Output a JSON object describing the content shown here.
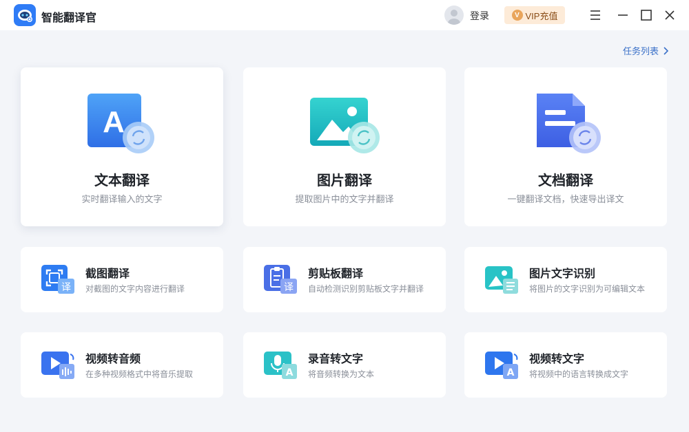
{
  "app": {
    "title": "智能翻译官",
    "login": "登录",
    "vip_label": "VIP充值",
    "vip_badge": "V"
  },
  "task_list": {
    "label": "任务列表"
  },
  "big_cards": [
    {
      "title": "文本翻译",
      "desc": "实时翻译输入的文字",
      "icon": "text-translate-icon"
    },
    {
      "title": "图片翻译",
      "desc": "提取图片中的文字并翻译",
      "icon": "image-translate-icon"
    },
    {
      "title": "文档翻译",
      "desc": "一键翻译文档，快速导出译文",
      "icon": "document-translate-icon"
    }
  ],
  "small_cards": [
    {
      "title": "截图翻译",
      "desc": "对截图的文字内容进行翻译",
      "icon": "screenshot-translate-icon",
      "badge": "译"
    },
    {
      "title": "剪贴板翻译",
      "desc": "自动检测识别剪贴板文字并翻译",
      "icon": "clipboard-translate-icon",
      "badge": "译"
    },
    {
      "title": "图片文字识别",
      "desc": "将图片的文字识别为可编辑文本",
      "icon": "image-ocr-icon"
    },
    {
      "title": "视频转音频",
      "desc": "在多种视频格式中将音乐提取",
      "icon": "video-to-audio-icon"
    },
    {
      "title": "录音转文字",
      "desc": "将音频转换为文本",
      "icon": "audio-to-text-icon",
      "badge": "A"
    },
    {
      "title": "视频转文字",
      "desc": "将视频中的语言转换成文字",
      "icon": "video-to-text-icon",
      "badge": "A"
    }
  ],
  "big_icon_letter": "A",
  "colors": {
    "brand": "#2f7cf6",
    "link": "#3a70c8",
    "vip_bg": "#fdebd8",
    "background": "#f3f5f9"
  }
}
